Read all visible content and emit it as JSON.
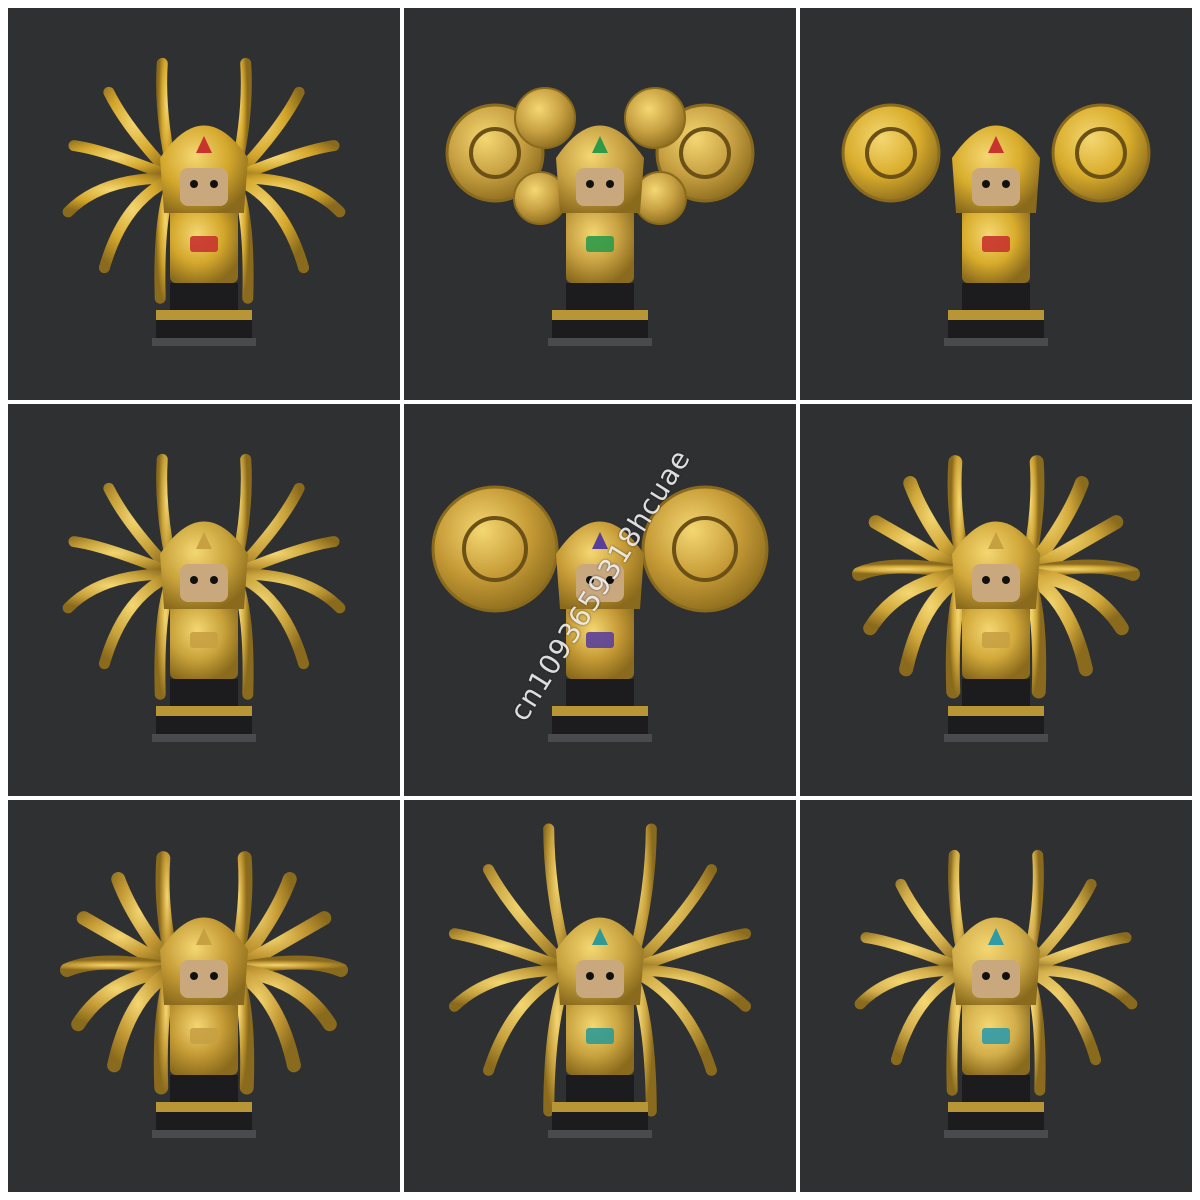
{
  "figures": [
    {
      "id": 1,
      "eye_color": "#c8332e",
      "accent": "#d4a72c",
      "wing": "spikes"
    },
    {
      "id": 2,
      "eye_color": "#2e9a48",
      "accent": "#c7a042",
      "wing": "discs"
    },
    {
      "id": 3,
      "eye_color": "#c8332e",
      "accent": "#d9ad2c",
      "wing": "rings"
    },
    {
      "id": 4,
      "eye_color": "#c7a042",
      "accent": "#c9a33b",
      "wing": "spikes"
    },
    {
      "id": 5,
      "eye_color": "#5a3f9a",
      "accent": "#c59a36",
      "wing": "shields"
    },
    {
      "id": 6,
      "eye_color": "#c7a042",
      "accent": "#d1a83a",
      "wing": "feathers"
    },
    {
      "id": 7,
      "eye_color": "#c7a042",
      "accent": "#c49a35",
      "wing": "feathers"
    },
    {
      "id": 8,
      "eye_color": "#2f9a95",
      "accent": "#c9a440",
      "wing": "tentacles"
    },
    {
      "id": 9,
      "eye_color": "#2f9aa8",
      "accent": "#d3af4c",
      "wing": "spikes"
    }
  ],
  "colors": {
    "background": "#2f3032",
    "gold": "#caa53a",
    "gold_dark": "#8a6a1c",
    "base": "#1c1c1e"
  },
  "watermark": {
    "text": "cn1093659318hcuae"
  }
}
